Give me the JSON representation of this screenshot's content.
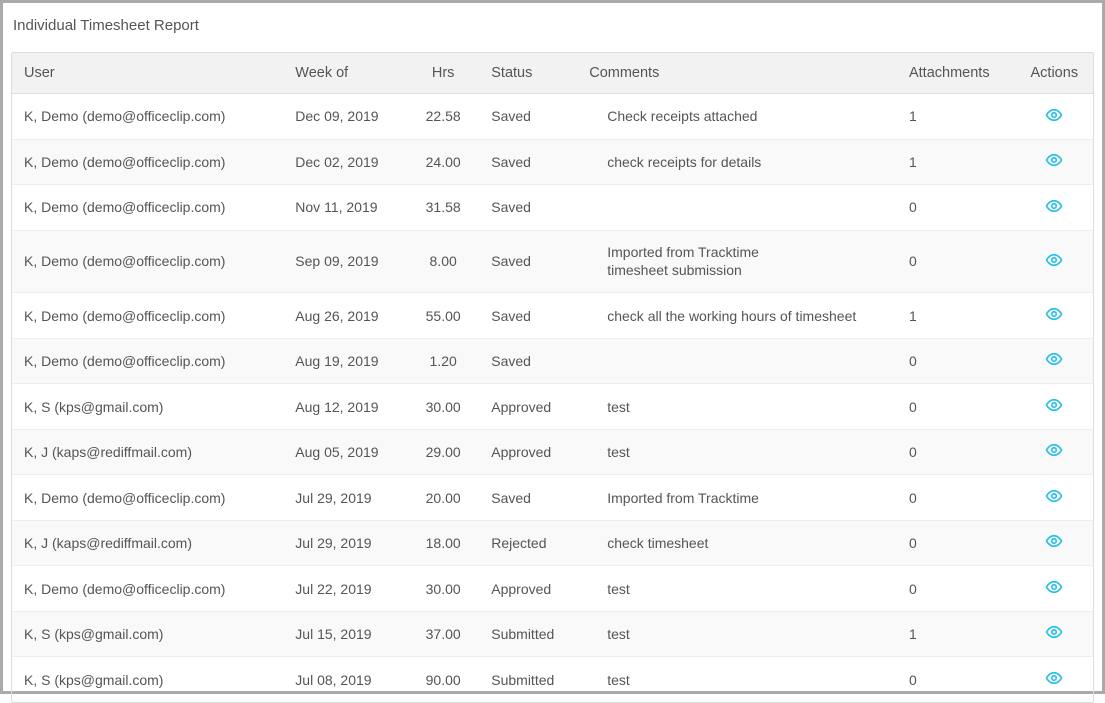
{
  "page": {
    "title": "Individual Timesheet Report"
  },
  "table": {
    "headers": {
      "user": "User",
      "week": "Week of",
      "hrs": "Hrs",
      "status": "Status",
      "comments": "Comments",
      "attachments": "Attachments",
      "actions": "Actions"
    },
    "rows": [
      {
        "user": "K, Demo (demo@officeclip.com)",
        "week": "Dec 09, 2019",
        "hrs": "22.58",
        "status": "Saved",
        "comments": "Check receipts attached",
        "attachments": "1"
      },
      {
        "user": "K, Demo (demo@officeclip.com)",
        "week": "Dec 02, 2019",
        "hrs": "24.00",
        "status": "Saved",
        "comments": "check receipts for details",
        "attachments": "1"
      },
      {
        "user": "K, Demo (demo@officeclip.com)",
        "week": "Nov 11, 2019",
        "hrs": "31.58",
        "status": "Saved",
        "comments": "",
        "attachments": "0"
      },
      {
        "user": "K, Demo (demo@officeclip.com)",
        "week": "Sep 09, 2019",
        "hrs": "8.00",
        "status": "Saved",
        "comments": "Imported from Tracktime\ntimesheet submission",
        "attachments": "0"
      },
      {
        "user": "K, Demo (demo@officeclip.com)",
        "week": "Aug 26, 2019",
        "hrs": "55.00",
        "status": "Saved",
        "comments": "check all the working hours of timesheet",
        "attachments": "1"
      },
      {
        "user": "K, Demo (demo@officeclip.com)",
        "week": "Aug 19, 2019",
        "hrs": "1.20",
        "status": "Saved",
        "comments": "",
        "attachments": "0"
      },
      {
        "user": "K, S (kps@gmail.com)",
        "week": "Aug 12, 2019",
        "hrs": "30.00",
        "status": "Approved",
        "comments": "test",
        "attachments": "0"
      },
      {
        "user": "K, J (kaps@rediffmail.com)",
        "week": "Aug 05, 2019",
        "hrs": "29.00",
        "status": "Approved",
        "comments": "test",
        "attachments": "0"
      },
      {
        "user": "K, Demo (demo@officeclip.com)",
        "week": "Jul 29, 2019",
        "hrs": "20.00",
        "status": "Saved",
        "comments": "Imported from Tracktime",
        "attachments": "0"
      },
      {
        "user": "K, J (kaps@rediffmail.com)",
        "week": "Jul 29, 2019",
        "hrs": "18.00",
        "status": "Rejected",
        "comments": "check timesheet",
        "attachments": "0"
      },
      {
        "user": "K, Demo (demo@officeclip.com)",
        "week": "Jul 22, 2019",
        "hrs": "30.00",
        "status": "Approved",
        "comments": "test",
        "attachments": "0"
      },
      {
        "user": "K, S (kps@gmail.com)",
        "week": "Jul 15, 2019",
        "hrs": "37.00",
        "status": "Submitted",
        "comments": "test",
        "attachments": "1"
      },
      {
        "user": "K, S (kps@gmail.com)",
        "week": "Jul 08, 2019",
        "hrs": "90.00",
        "status": "Submitted",
        "comments": "test",
        "attachments": "0"
      }
    ]
  }
}
